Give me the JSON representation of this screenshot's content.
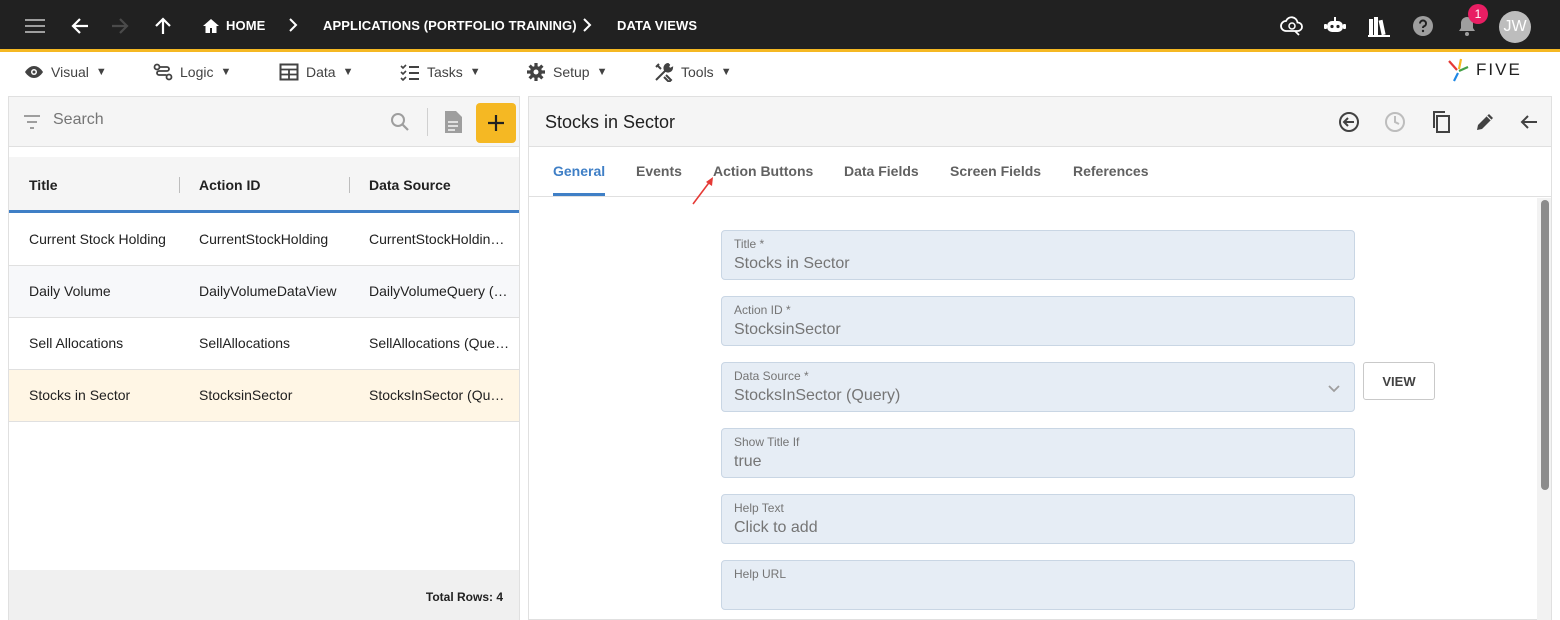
{
  "topbar": {
    "breadcrumbs": [
      "HOME",
      "APPLICATIONS (PORTFOLIO TRAINING)",
      "DATA VIEWS"
    ],
    "notification_count": "1",
    "avatar_initials": "JW",
    "icons": [
      "menu-icon",
      "back-arrow-icon",
      "forward-arrow-icon",
      "up-arrow-icon",
      "home-icon",
      "cloud-sync-icon",
      "chatbot-icon",
      "library-icon",
      "help-icon",
      "bell-icon"
    ],
    "accent_color": "#f5b823"
  },
  "menubar": {
    "items": [
      {
        "label": "Visual",
        "icon": "eye-icon"
      },
      {
        "label": "Logic",
        "icon": "flow-icon"
      },
      {
        "label": "Data",
        "icon": "table-icon"
      },
      {
        "label": "Tasks",
        "icon": "checklist-icon"
      },
      {
        "label": "Setup",
        "icon": "gear-icon"
      },
      {
        "label": "Tools",
        "icon": "tools-icon"
      }
    ],
    "caret": "▼",
    "logo_text": "FIVE"
  },
  "list": {
    "search_placeholder": "Search",
    "columns": [
      "Title",
      "Action ID",
      "Data Source"
    ],
    "rows": [
      [
        "Current Stock Holding",
        "CurrentStockHolding",
        "CurrentStockHolding (Query)"
      ],
      [
        "Daily Volume",
        "DailyVolumeDataView",
        "DailyVolumeQuery (Query)"
      ],
      [
        "Sell Allocations",
        "SellAllocations",
        "SellAllocations (Query)"
      ],
      [
        "Stocks in Sector",
        "StocksinSector",
        "StocksInSector (Query)"
      ]
    ],
    "selected_row": 3,
    "total_rows": "Total Rows: 4"
  },
  "detail": {
    "title": "Stocks in Sector",
    "tabs": [
      "General",
      "Events",
      "Action Buttons",
      "Data Fields",
      "Screen Fields",
      "References"
    ],
    "active_tab": "General",
    "fields": [
      {
        "label": "Title *",
        "value": "Stocks in Sector"
      },
      {
        "label": "Action ID *",
        "value": "StocksinSector"
      },
      {
        "label": "Data Source *",
        "value": "StocksInSector (Query)"
      },
      {
        "label": "Show Title If",
        "value": "true"
      },
      {
        "label": "Help Text",
        "value": "Click to add"
      },
      {
        "label": "Help URL",
        "value": ""
      }
    ],
    "view_button": "VIEW",
    "accent_color": "#3f7fc6"
  }
}
